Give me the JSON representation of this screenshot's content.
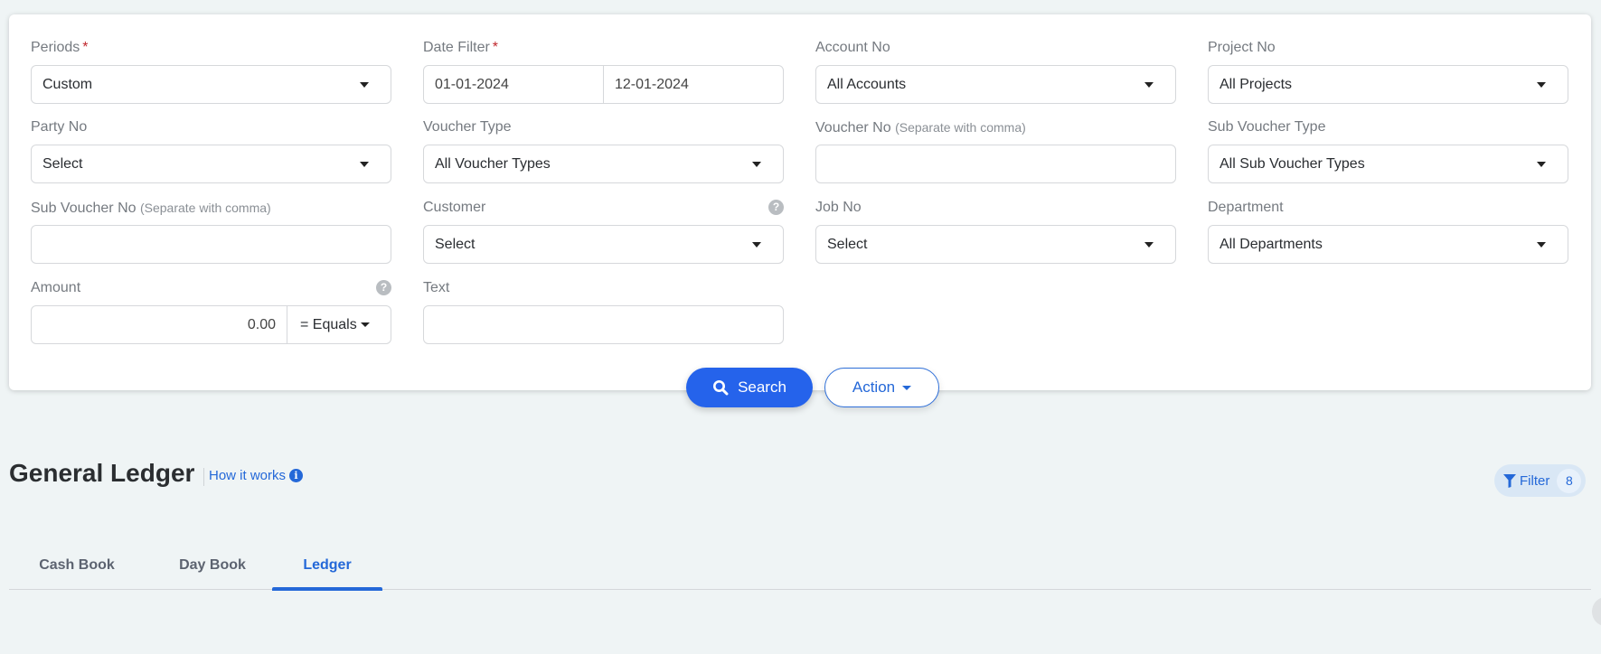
{
  "filters": {
    "periods": {
      "label": "Periods",
      "required": "*",
      "value": "Custom"
    },
    "date_filter": {
      "label": "Date Filter",
      "required": "*",
      "from": "01-01-2024",
      "to": "12-01-2024"
    },
    "account_no": {
      "label": "Account No",
      "value": "All Accounts"
    },
    "project_no": {
      "label": "Project No",
      "value": "All Projects"
    },
    "party_no": {
      "label": "Party No",
      "value": "Select"
    },
    "voucher_type": {
      "label": "Voucher Type",
      "value": "All Voucher Types"
    },
    "voucher_no": {
      "label": "Voucher No",
      "hint": "(Separate with comma)",
      "value": ""
    },
    "sub_voucher_type": {
      "label": "Sub Voucher Type",
      "value": "All Sub Voucher Types"
    },
    "sub_voucher_no": {
      "label": "Sub Voucher No",
      "hint": "(Separate with comma)",
      "value": ""
    },
    "customer": {
      "label": "Customer",
      "value": "Select",
      "help": "?"
    },
    "job_no": {
      "label": "Job No",
      "value": "Select"
    },
    "department": {
      "label": "Department",
      "value": "All Departments"
    },
    "amount": {
      "label": "Amount",
      "value": "0.00",
      "operator": "= Equals",
      "help": "?"
    },
    "text": {
      "label": "Text",
      "value": ""
    }
  },
  "actions": {
    "search_label": "Search",
    "action_label": "Action"
  },
  "header": {
    "title": "General Ledger",
    "how_it_works": "How it works",
    "info_glyph": "i",
    "filter_label": "Filter",
    "filter_count": "8"
  },
  "tabs": [
    {
      "label": "Cash Book",
      "active": false
    },
    {
      "label": "Day Book",
      "active": false
    },
    {
      "label": "Ledger",
      "active": true
    }
  ],
  "colors": {
    "primary": "#2563eb",
    "link": "#2468d8",
    "required": "#c0262c"
  }
}
